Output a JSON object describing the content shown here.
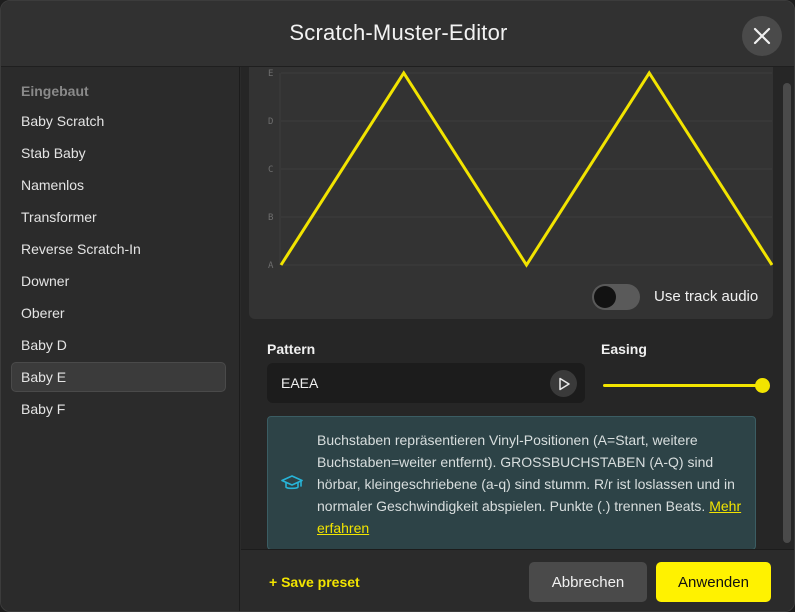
{
  "window": {
    "title": "Scratch-Muster-Editor"
  },
  "sidebar": {
    "heading": "Eingebaut",
    "items": [
      {
        "label": "Baby Scratch"
      },
      {
        "label": "Stab Baby"
      },
      {
        "label": "Namenlos"
      },
      {
        "label": "Transformer"
      },
      {
        "label": "Reverse Scratch-In"
      },
      {
        "label": "Downer"
      },
      {
        "label": "Oberer"
      },
      {
        "label": "Baby D"
      },
      {
        "label": "Baby E",
        "selected": true
      },
      {
        "label": "Baby F"
      }
    ]
  },
  "chart_data": {
    "type": "line",
    "y_categories": [
      "A",
      "B",
      "C",
      "D",
      "E"
    ],
    "series": [
      {
        "values": [
          "A",
          "E",
          "A",
          "E",
          "A"
        ]
      }
    ],
    "color": "#f2e400",
    "grid": true
  },
  "track_audio": {
    "label": "Use track audio",
    "enabled": false
  },
  "pattern": {
    "label": "Pattern",
    "value": "EAEA"
  },
  "easing": {
    "label": "Easing",
    "value": 1.0
  },
  "info": {
    "text": "Buchstaben repräsentieren Vinyl-Positionen (A=Start, weitere Buchstaben=weiter entfernt). GROSSBUCHSTABEN (A-Q) sind hörbar, kleingeschriebene (a-q) sind stumm. R/r ist loslassen und in normaler Geschwindigkeit abspielen. Punkte (.) trennen Beats.",
    "link": "Mehr erfahren"
  },
  "footer": {
    "save_preset": "+ Save preset",
    "cancel": "Abbrechen",
    "apply": "Anwenden"
  },
  "icons": {
    "close": "close-icon",
    "play": "play-icon",
    "info": "graduation-cap-icon"
  },
  "colors": {
    "accent": "#f2e400",
    "info_bg": "#2d4347"
  }
}
